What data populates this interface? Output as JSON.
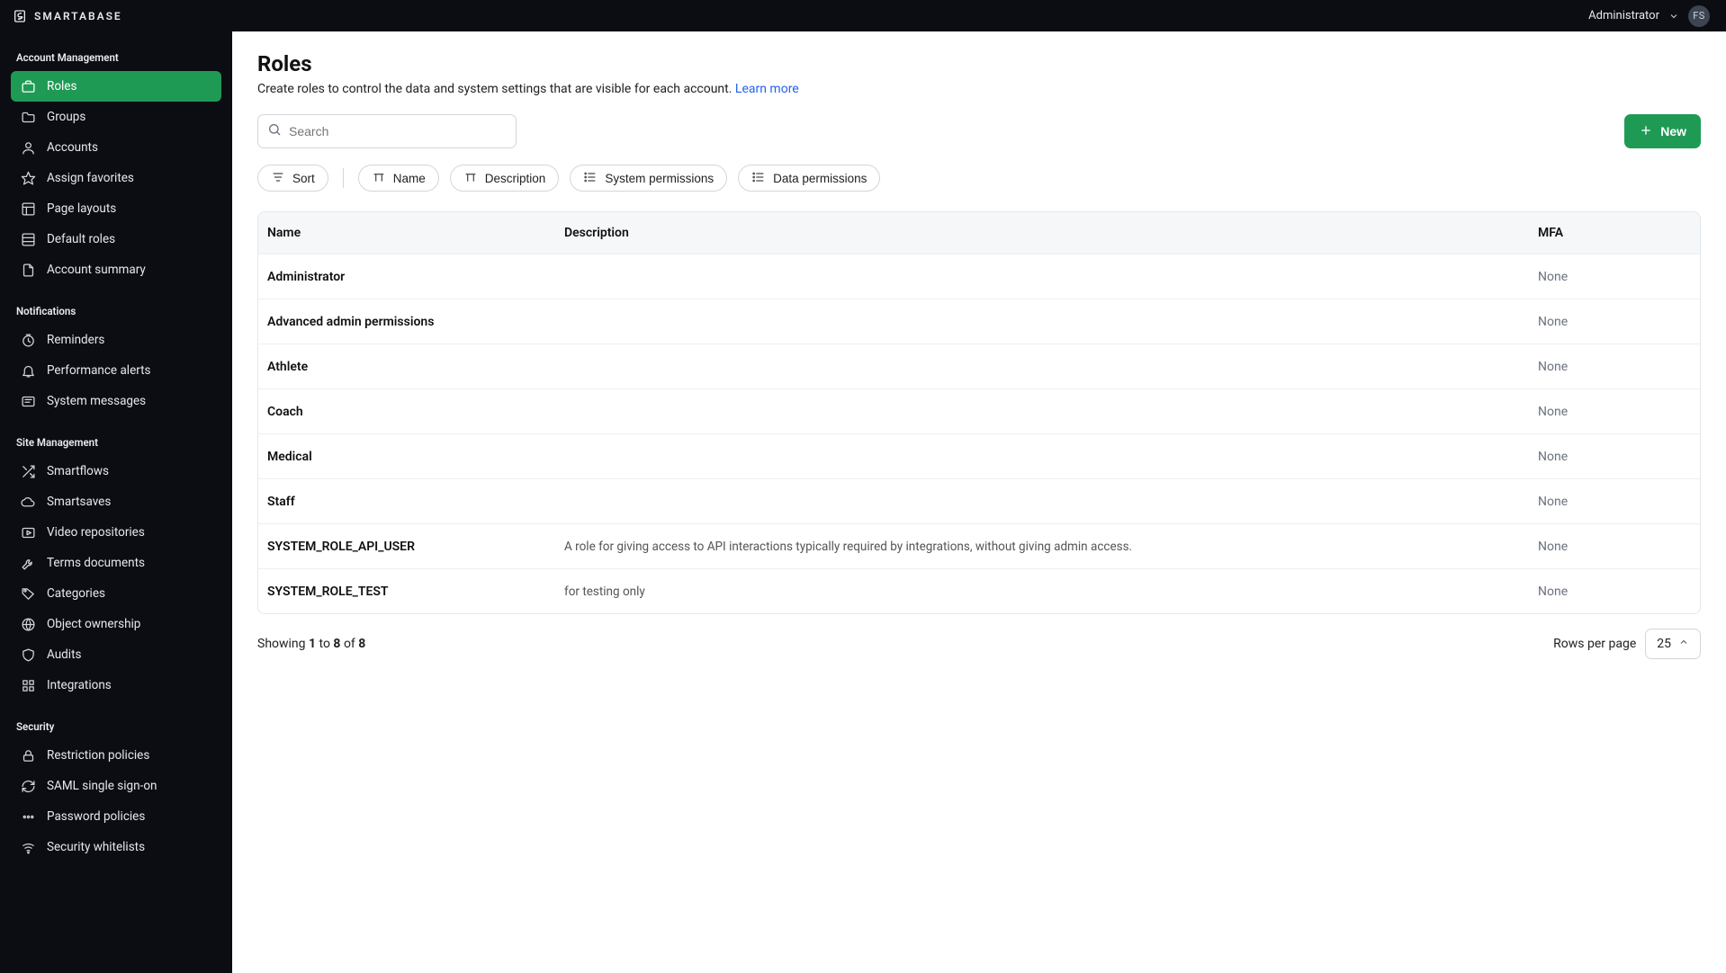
{
  "header": {
    "brand": "SMARTABASE",
    "user_label": "Administrator",
    "avatar_initials": "FS"
  },
  "sidebar": {
    "sections": [
      {
        "title": "Account Management",
        "items": [
          {
            "label": "Roles",
            "icon": "briefcase-icon",
            "active": true
          },
          {
            "label": "Groups",
            "icon": "folder-icon"
          },
          {
            "label": "Accounts",
            "icon": "user-icon"
          },
          {
            "label": "Assign favorites",
            "icon": "star-icon"
          },
          {
            "label": "Page layouts",
            "icon": "layout-icon"
          },
          {
            "label": "Default roles",
            "icon": "layers-icon"
          },
          {
            "label": "Account summary",
            "icon": "file-icon"
          }
        ]
      },
      {
        "title": "Notifications",
        "items": [
          {
            "label": "Reminders",
            "icon": "clock-icon"
          },
          {
            "label": "Performance alerts",
            "icon": "bell-icon"
          },
          {
            "label": "System messages",
            "icon": "message-icon"
          }
        ]
      },
      {
        "title": "Site Management",
        "items": [
          {
            "label": "Smartflows",
            "icon": "shuffle-icon"
          },
          {
            "label": "Smartsaves",
            "icon": "cloud-icon"
          },
          {
            "label": "Video repositories",
            "icon": "video-icon"
          },
          {
            "label": "Terms documents",
            "icon": "tool-icon"
          },
          {
            "label": "Categories",
            "icon": "tag-icon"
          },
          {
            "label": "Object ownership",
            "icon": "globe-icon"
          },
          {
            "label": "Audits",
            "icon": "shield-icon"
          },
          {
            "label": "Integrations",
            "icon": "grid-icon"
          }
        ]
      },
      {
        "title": "Security",
        "items": [
          {
            "label": "Restriction policies",
            "icon": "lock-icon"
          },
          {
            "label": "SAML single sign-on",
            "icon": "refresh-icon"
          },
          {
            "label": "Password policies",
            "icon": "dots-icon"
          },
          {
            "label": "Security whitelists",
            "icon": "wifi-icon"
          }
        ]
      }
    ]
  },
  "page": {
    "title": "Roles",
    "subtitle_prefix": "Create roles to control the data and system settings that are visible for each account. ",
    "learn_more": "Learn more",
    "search_placeholder": "Search",
    "new_button": "New",
    "filter_sort": "Sort",
    "filter_name": "Name",
    "filter_description": "Description",
    "filter_system_permissions": "System permissions",
    "filter_data_permissions": "Data permissions",
    "rows_per_page_label": "Rows per page",
    "rows_per_page_value": "25",
    "showing_word": "Showing ",
    "to_word": " to ",
    "of_word": " of ",
    "showing_from": "1",
    "showing_to": "8",
    "showing_of": "8"
  },
  "table": {
    "headers": {
      "name": "Name",
      "description": "Description",
      "mfa": "MFA"
    },
    "rows": [
      {
        "name": "Administrator",
        "description": "",
        "mfa": "None"
      },
      {
        "name": "Advanced admin permissions",
        "description": "",
        "mfa": "None"
      },
      {
        "name": "Athlete",
        "description": "",
        "mfa": "None"
      },
      {
        "name": "Coach",
        "description": "",
        "mfa": "None"
      },
      {
        "name": "Medical",
        "description": "",
        "mfa": "None"
      },
      {
        "name": "Staff",
        "description": "",
        "mfa": "None"
      },
      {
        "name": "SYSTEM_ROLE_API_USER",
        "description": "A role for giving access to API interactions typically required by integrations, without giving admin access.",
        "mfa": "None"
      },
      {
        "name": "SYSTEM_ROLE_TEST",
        "description": "for testing only",
        "mfa": "None"
      }
    ]
  }
}
